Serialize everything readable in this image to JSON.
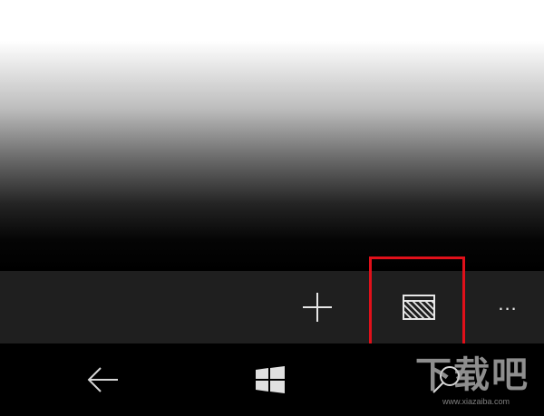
{
  "app_bar": {
    "buttons": [
      {
        "icon": "plus-icon"
      },
      {
        "icon": "view-layout-icon"
      },
      {
        "icon": "more-icon",
        "label": "..."
      }
    ],
    "highlight_color": "#e0101a"
  },
  "nav_bar": {
    "buttons": [
      {
        "icon": "back-arrow-icon"
      },
      {
        "icon": "windows-logo-icon"
      },
      {
        "icon": "search-icon"
      }
    ]
  },
  "watermark": {
    "text": "下载吧",
    "url": "www.xiazaiba.com"
  }
}
